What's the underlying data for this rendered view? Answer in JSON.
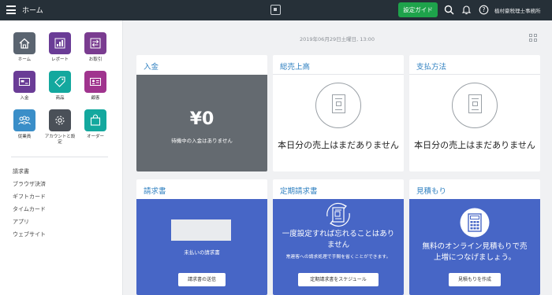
{
  "topbar": {
    "title": "ホーム",
    "setup_guide": "設定ガイド",
    "office_name": "植村豪税理士事務所"
  },
  "sidebar": {
    "tiles": [
      {
        "label": "ホーム",
        "color": "#5a6470",
        "icon": "home-icon"
      },
      {
        "label": "レポート",
        "color": "#6a3c96",
        "icon": "bar-chart-icon"
      },
      {
        "label": "お取引",
        "color": "#7a3c90",
        "icon": "transfer-icon"
      },
      {
        "label": "入金",
        "color": "#6a3c96",
        "icon": "deposit-icon"
      },
      {
        "label": "商品",
        "color": "#13a89e",
        "icon": "tag-icon"
      },
      {
        "label": "顧客",
        "color": "#a0348e",
        "icon": "id-card-icon"
      },
      {
        "label": "従業員",
        "color": "#3a8ec8",
        "icon": "people-icon"
      },
      {
        "label": "アカウントと設定",
        "color": "#4a5058",
        "icon": "gear-icon"
      },
      {
        "label": "オーダー",
        "color": "#13a89e",
        "icon": "bag-icon"
      }
    ],
    "links": [
      "請求書",
      "ブラウザ決済",
      "ギフトカード",
      "タイムカード",
      "アプリ",
      "ウェブサイト"
    ]
  },
  "date_line": "2019年06月29日土曜日, 13:00",
  "cards": {
    "deposit": {
      "title": "入金",
      "amount": "¥0",
      "subtitle": "待機中の入金はありません"
    },
    "gross_sales": {
      "title": "総売上高",
      "message": "本日分の売上はまだありません"
    },
    "payment_method": {
      "title": "支払方法",
      "message": "本日分の売上はまだありません"
    },
    "invoices": {
      "title": "請求書",
      "status": "未払いの請求書",
      "button": "請求書の送信"
    },
    "recurring": {
      "title": "定期請求書",
      "headline": "一度設定すれば忘れることはありません",
      "sub": "常連客への請求処理で手間を省くことができます。",
      "button": "定期請求書をスケジュール"
    },
    "estimates": {
      "title": "見積もり",
      "headline": "無料のオンライン見積もりで売上増につなげましょう。",
      "button": "見積もりを作成"
    }
  }
}
